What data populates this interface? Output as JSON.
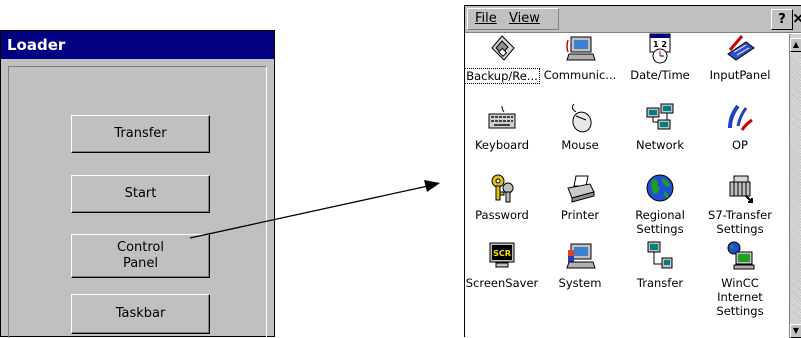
{
  "loader": {
    "title": "Loader",
    "buttons": [
      {
        "label": "Transfer"
      },
      {
        "label": "Start"
      },
      {
        "label": "Control\nPanel"
      },
      {
        "label": "Taskbar"
      }
    ]
  },
  "control_panel": {
    "menu": {
      "file": "File",
      "view": "View"
    },
    "help_label": "?",
    "close_label": "×",
    "icons": [
      {
        "label": "Backup/Re...",
        "icon": "backup-disk-icon"
      },
      {
        "label": "Communic...",
        "icon": "communication-computer-icon"
      },
      {
        "label": "Date/Time",
        "icon": "calendar-clock-icon"
      },
      {
        "label": "InputPanel",
        "icon": "keyboard-pen-icon"
      },
      {
        "label": "Keyboard",
        "icon": "keyboard-icon"
      },
      {
        "label": "Mouse",
        "icon": "mouse-icon"
      },
      {
        "label": "Network",
        "icon": "network-icon"
      },
      {
        "label": "OP",
        "icon": "op-icon"
      },
      {
        "label": "Password",
        "icon": "keys-icon"
      },
      {
        "label": "Printer",
        "icon": "printer-icon"
      },
      {
        "label": "Regional\nSettings",
        "icon": "globe-icon"
      },
      {
        "label": "S7-Transfer\nSettings",
        "icon": "s7-transfer-icon"
      },
      {
        "label": "ScreenSaver",
        "icon": "screensaver-icon"
      },
      {
        "label": "System",
        "icon": "system-computer-icon"
      },
      {
        "label": "Transfer",
        "icon": "transfer-computers-icon"
      },
      {
        "label": "WinCC\nInternet\nSettings",
        "icon": "wincc-internet-icon"
      }
    ]
  }
}
